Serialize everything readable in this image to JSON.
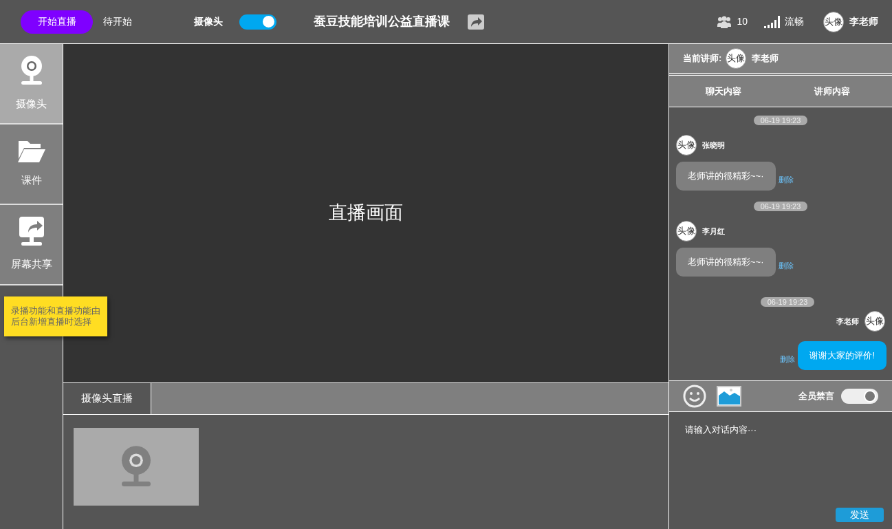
{
  "top_bar": {
    "start_button": "开始直播",
    "status": "待开始",
    "camera_label": "摄像头",
    "camera_on": true,
    "title": "蚕豆技能培训公益直播课",
    "viewers": "10",
    "network": "流畅",
    "avatar": "头像",
    "user": "李老师"
  },
  "sidebar": {
    "items": [
      {
        "label": "摄像头",
        "kind": "camera",
        "selected": true
      },
      {
        "label": "课件",
        "kind": "folder",
        "selected": false
      },
      {
        "label": "屏幕共享",
        "kind": "share",
        "selected": false
      }
    ],
    "note": "录播功能和直播功能由后台新增直播时选择"
  },
  "stage": {
    "label": "直播画面"
  },
  "bottom": {
    "tabs": [
      {
        "label": "摄像头直播",
        "selected": true
      }
    ]
  },
  "chat": {
    "teacher_label": "当前讲师:",
    "teacher_avatar": "头像",
    "teacher_name": "李老师",
    "tabs": [
      {
        "label": "聊天内容",
        "selected": false
      },
      {
        "label": "讲师内容",
        "selected": false
      }
    ],
    "messages": [
      {
        "kind": "received",
        "time": "06-19 19:23",
        "avatar": "头像",
        "name": "张晓明",
        "text": "老师讲的很精彩~~·",
        "delete": "删除"
      },
      {
        "kind": "received",
        "time": "06-19 19:23",
        "avatar": "头像",
        "name": "李月红",
        "text": "老师讲的很精彩~~·",
        "delete": "删除"
      },
      {
        "kind": "sent",
        "time": "06-19 19:23",
        "avatar": "头像",
        "name": "李老师",
        "text": "谢谢大家的评价!",
        "delete": "删除"
      }
    ],
    "mute_all_label": "全员禁言",
    "mute_all_on": true,
    "placeholder": "请输入对话内容···",
    "send": "发送"
  }
}
